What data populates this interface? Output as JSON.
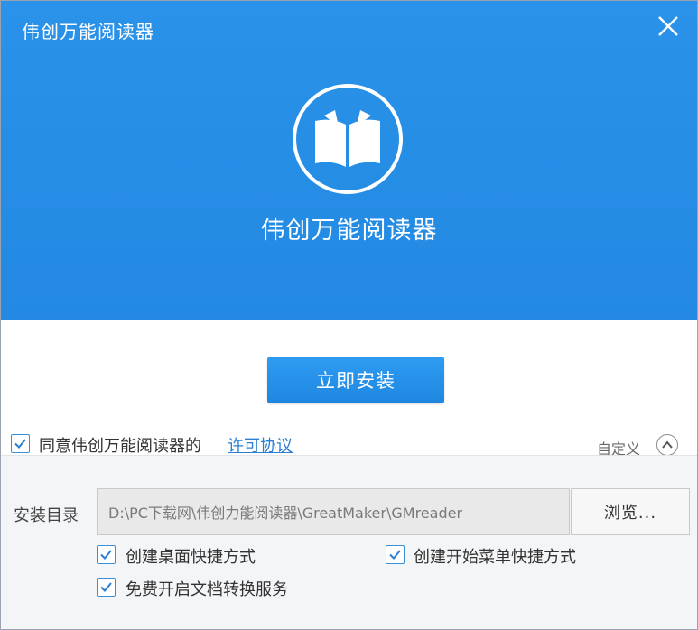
{
  "window": {
    "title": "伟创万能阅读器"
  },
  "banner": {
    "app_name": "伟创万能阅读器"
  },
  "install": {
    "button_label": "立即安装"
  },
  "agreement": {
    "checked": true,
    "text": "同意伟创万能阅读器的",
    "link_text": "许可协议"
  },
  "customize": {
    "label": "自定义"
  },
  "install_dir": {
    "label": "安装目录",
    "value": "D:\\PC下载网\\伟创力能阅读器\\GreatMaker\\GMreader",
    "browse_label": "浏览..."
  },
  "options": [
    {
      "label": "创建桌面快捷方式",
      "checked": true
    },
    {
      "label": "创建开始菜单快捷方式",
      "checked": true
    },
    {
      "label": "免费开启文档转换服务",
      "checked": true
    }
  ],
  "colors": {
    "accent": "#2389e3",
    "link": "#2a7fd4"
  }
}
